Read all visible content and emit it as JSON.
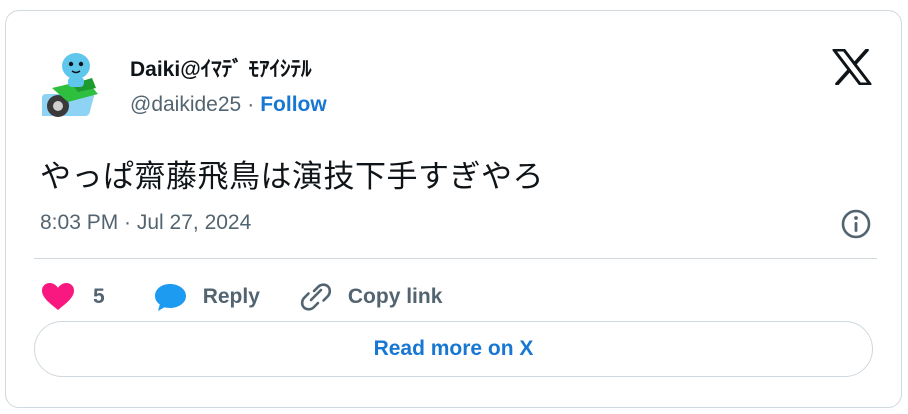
{
  "author": {
    "display_name": "Daiki@ｲﾏﾃﾞ ﾓｱｲｼﾃﾙ",
    "handle": "@daikide25",
    "separator": "·",
    "follow_label": "Follow"
  },
  "tweet": {
    "text": "やっぱ齋藤飛鳥は演技下手すぎやろ",
    "timestamp": "8:03 PM · Jul 27, 2024"
  },
  "actions": {
    "like_count": "5",
    "reply_label": "Reply",
    "copy_link_label": "Copy link"
  },
  "read_more_label": "Read more on X",
  "icons": {
    "brand": "x-logo-icon",
    "info": "info-icon",
    "like": "heart-icon",
    "reply": "reply-bubble-icon",
    "copy": "link-icon"
  },
  "colors": {
    "like": "#f91880",
    "reply": "#1d9bf0",
    "link_blue": "#1877d2",
    "muted": "#536471",
    "border": "#cfd9de"
  }
}
